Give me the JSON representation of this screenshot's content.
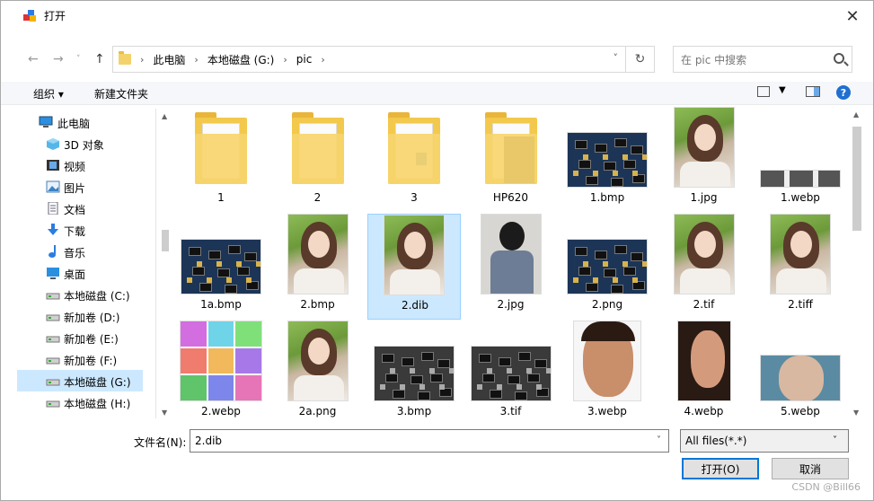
{
  "window": {
    "title": "打开"
  },
  "address": {
    "crumbs": [
      "此电脑",
      "本地磁盘 (G:)",
      "pic"
    ]
  },
  "search": {
    "placeholder": "在 pic 中搜索"
  },
  "toolbar": {
    "organize": "组织 ▾",
    "new_folder": "新建文件夹"
  },
  "sidebar": {
    "items": [
      {
        "label": "此电脑",
        "icon": "computer-icon"
      },
      {
        "label": "3D 对象",
        "icon": "cube-icon"
      },
      {
        "label": "视频",
        "icon": "film-icon"
      },
      {
        "label": "图片",
        "icon": "image-icon"
      },
      {
        "label": "文档",
        "icon": "document-icon"
      },
      {
        "label": "下载",
        "icon": "download-icon"
      },
      {
        "label": "音乐",
        "icon": "music-icon"
      },
      {
        "label": "桌面",
        "icon": "desktop-icon"
      },
      {
        "label": "本地磁盘 (C:)",
        "icon": "drive-icon"
      },
      {
        "label": "新加卷 (D:)",
        "icon": "drive-icon"
      },
      {
        "label": "新加卷 (E:)",
        "icon": "drive-icon"
      },
      {
        "label": "新加卷 (F:)",
        "icon": "drive-icon"
      },
      {
        "label": "本地磁盘 (G:)",
        "icon": "drive-icon",
        "selected": true
      },
      {
        "label": "本地磁盘 (H:)",
        "icon": "drive-icon"
      }
    ]
  },
  "files": [
    {
      "name": "1",
      "kind": "folder"
    },
    {
      "name": "2",
      "kind": "folder"
    },
    {
      "name": "3",
      "kind": "folder"
    },
    {
      "name": "HP620",
      "kind": "folder"
    },
    {
      "name": "1.bmp",
      "kind": "pcb"
    },
    {
      "name": "1.jpg",
      "kind": "portrait"
    },
    {
      "name": "1.webp",
      "kind": "strip"
    },
    {
      "name": "1a.bmp",
      "kind": "pcb"
    },
    {
      "name": "2.bmp",
      "kind": "portrait"
    },
    {
      "name": "2.dib",
      "kind": "portrait",
      "selected": true
    },
    {
      "name": "2.jpg",
      "kind": "man"
    },
    {
      "name": "2.png",
      "kind": "pcb"
    },
    {
      "name": "2.tif",
      "kind": "portrait"
    },
    {
      "name": "2.tiff",
      "kind": "portrait"
    },
    {
      "name": "2.webp",
      "kind": "grid"
    },
    {
      "name": "2a.png",
      "kind": "portrait"
    },
    {
      "name": "3.bmp",
      "kind": "pcbgray"
    },
    {
      "name": "3.tif",
      "kind": "pcbgray"
    },
    {
      "name": "3.webp",
      "kind": "face"
    },
    {
      "name": "4.webp",
      "kind": "face2"
    },
    {
      "name": "5.webp",
      "kind": "face3"
    }
  ],
  "footer": {
    "filename_label": "文件名(N):",
    "filename_value": "2.dib",
    "filter": "All files(*.*)",
    "open": "打开(O)",
    "cancel": "取消"
  },
  "watermark": "CSDN @Bill66"
}
